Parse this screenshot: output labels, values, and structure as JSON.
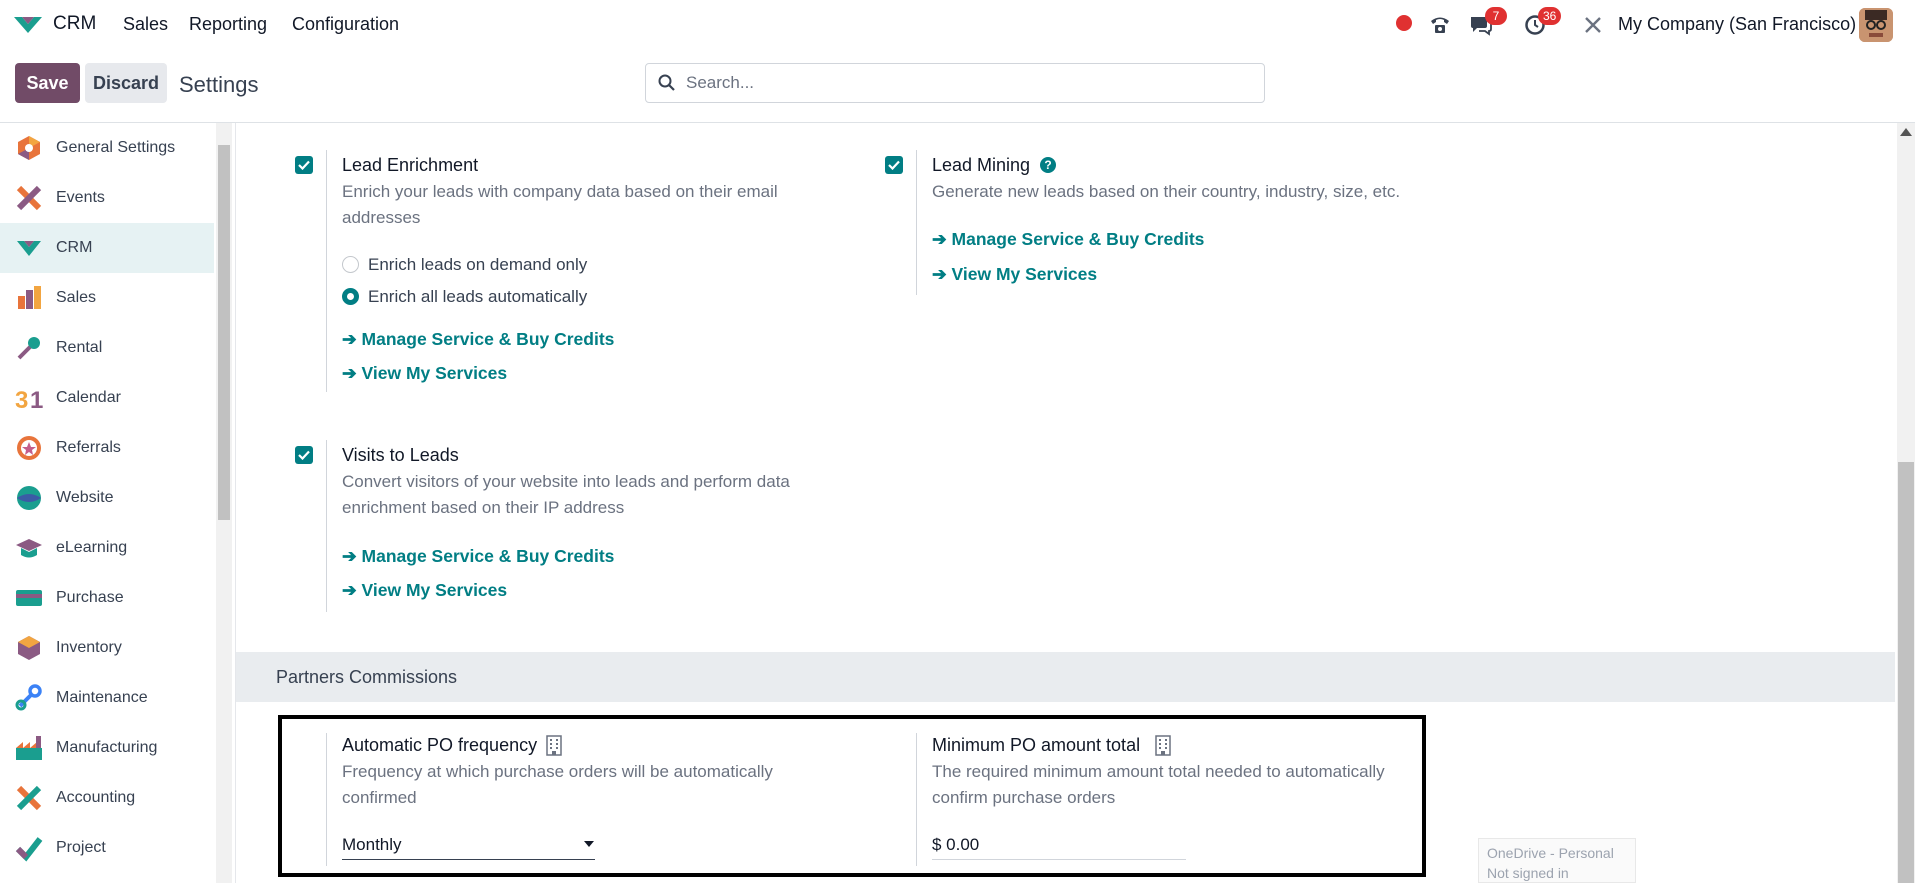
{
  "navbar": {
    "app_name": "CRM",
    "menu": [
      "Sales",
      "Reporting",
      "Configuration"
    ],
    "messages_count": "7",
    "activities_count": "36",
    "company": "My Company (San Francisco)"
  },
  "control_panel": {
    "save_label": "Save",
    "discard_label": "Discard",
    "title": "Settings",
    "search_placeholder": "Search..."
  },
  "sidebar": {
    "items": [
      {
        "label": "General Settings",
        "icon": "general-settings-icon"
      },
      {
        "label": "Events",
        "icon": "events-icon"
      },
      {
        "label": "CRM",
        "icon": "crm-icon",
        "active": true
      },
      {
        "label": "Sales",
        "icon": "sales-icon"
      },
      {
        "label": "Rental",
        "icon": "rental-icon"
      },
      {
        "label": "Calendar",
        "icon": "calendar-icon"
      },
      {
        "label": "Referrals",
        "icon": "referrals-icon"
      },
      {
        "label": "Website",
        "icon": "website-icon"
      },
      {
        "label": "eLearning",
        "icon": "elearning-icon"
      },
      {
        "label": "Purchase",
        "icon": "purchase-icon"
      },
      {
        "label": "Inventory",
        "icon": "inventory-icon"
      },
      {
        "label": "Maintenance",
        "icon": "maintenance-icon"
      },
      {
        "label": "Manufacturing",
        "icon": "manufacturing-icon"
      },
      {
        "label": "Accounting",
        "icon": "accounting-icon"
      },
      {
        "label": "Project",
        "icon": "project-icon"
      }
    ]
  },
  "settings": {
    "lead_enrichment": {
      "title": "Lead Enrichment",
      "desc_line1": "Enrich your leads with company data based on their email",
      "desc_line2": "addresses",
      "checked": true,
      "options": [
        "Enrich leads on demand only",
        "Enrich all leads automatically"
      ],
      "selected_option": "Enrich all leads automatically",
      "link_manage": "➔ Manage Service & Buy Credits",
      "link_view": "➔ View My Services"
    },
    "lead_mining": {
      "title": "Lead Mining",
      "desc": "Generate new leads based on their country, industry, size, etc.",
      "checked": true,
      "link_manage": "➔ Manage Service & Buy Credits",
      "link_view": "➔ View My Services"
    },
    "visits_to_leads": {
      "title": "Visits to Leads",
      "desc_line1": "Convert visitors of your website into leads and perform data",
      "desc_line2": "enrichment based on their IP address",
      "checked": true,
      "link_manage": "➔ Manage Service & Buy Credits",
      "link_view": "➔ View My Services"
    }
  },
  "partners_commissions": {
    "section_title": "Partners Commissions",
    "po_frequency": {
      "title": "Automatic PO frequency",
      "desc_line1": "Frequency at which purchase orders will be automatically",
      "desc_line2": "confirmed",
      "value": "Monthly"
    },
    "min_po_amount": {
      "title": "Minimum PO amount total",
      "desc_line1": "The required minimum amount total needed to automatically",
      "desc_line2": "confirm purchase orders",
      "value": "$ 0.00"
    }
  },
  "onedrive": {
    "line1": "OneDrive - Personal",
    "line2": "Not signed in"
  },
  "colors": {
    "brand": "#714b67",
    "accent": "#017e84",
    "badge": "#e03131"
  }
}
